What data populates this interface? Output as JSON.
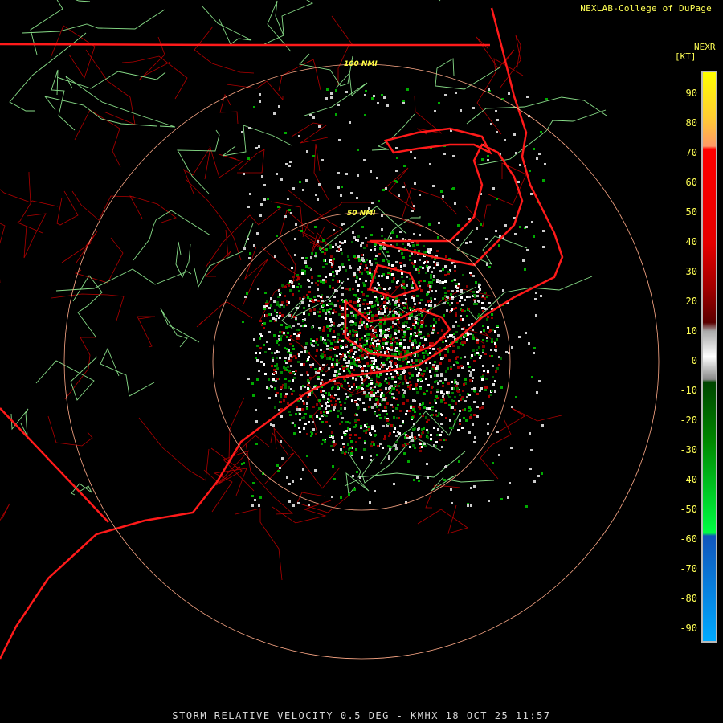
{
  "credit": "NEXLAB-College of DuPage",
  "footer": "STORM RELATIVE VELOCITY 0.5 DEG - KMHX 18 OCT 25 11:57",
  "legend": {
    "title": "NEXR",
    "unit": "[KT]",
    "ticks": [
      "90",
      "80",
      "70",
      "60",
      "50",
      "40",
      "30",
      "20",
      "10",
      "0",
      "-10",
      "-20",
      "-30",
      "-40",
      "-50",
      "-60",
      "-70",
      "-80",
      "-90"
    ],
    "stops": [
      {
        "at": 0.0,
        "color": "#ffff00"
      },
      {
        "at": 0.08,
        "color": "#ffcc33"
      },
      {
        "at": 0.13,
        "color": "#ff9966"
      },
      {
        "at": 0.135,
        "color": "#ff0000"
      },
      {
        "at": 0.3,
        "color": "#e60000"
      },
      {
        "at": 0.38,
        "color": "#a00000"
      },
      {
        "at": 0.44,
        "color": "#5a0000"
      },
      {
        "at": 0.455,
        "color": "#aaaaaa"
      },
      {
        "at": 0.5,
        "color": "#ffffff"
      },
      {
        "at": 0.54,
        "color": "#888888"
      },
      {
        "at": 0.545,
        "color": "#004400"
      },
      {
        "at": 0.65,
        "color": "#008800"
      },
      {
        "at": 0.81,
        "color": "#00ff44"
      },
      {
        "at": 0.815,
        "color": "#1155bb"
      },
      {
        "at": 1.0,
        "color": "#00aaff"
      }
    ]
  },
  "range_rings": {
    "labels": [
      "50 NMI",
      "100 NMI"
    ]
  },
  "colors": {
    "state_border": "#ff0000",
    "county_line": "#b00000",
    "highway": "#88dd88",
    "interstate": "#ffff88",
    "ring": "#ffaa88"
  }
}
